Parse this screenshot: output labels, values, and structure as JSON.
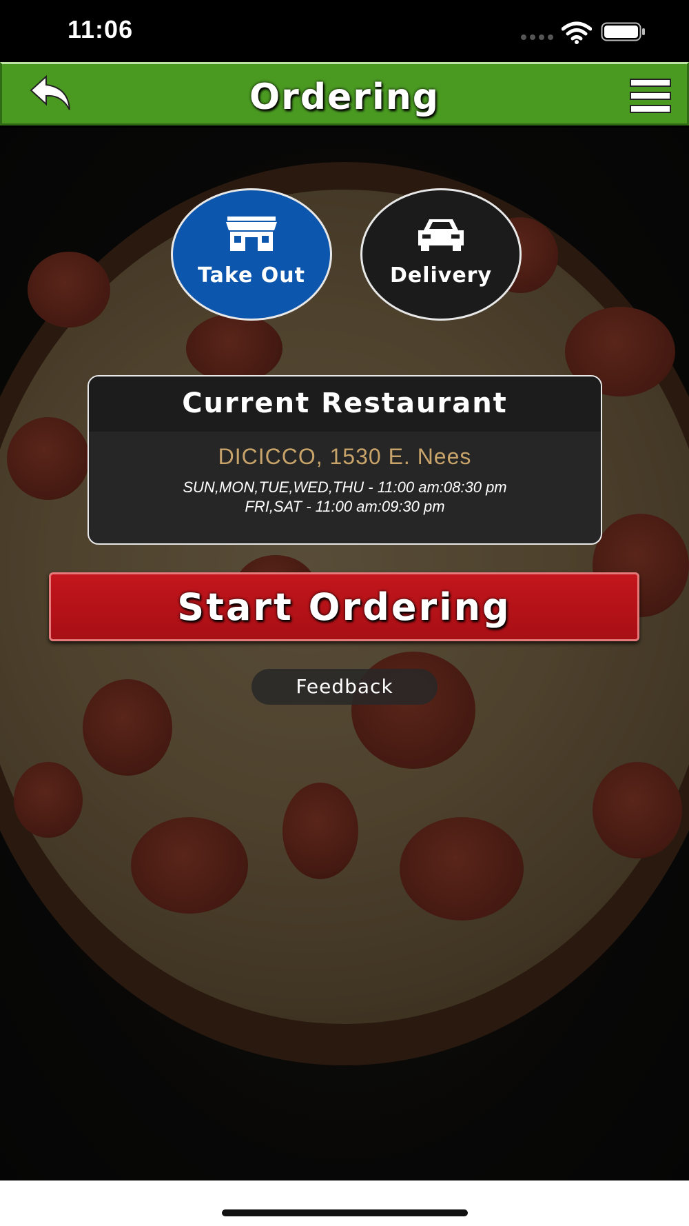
{
  "status_bar": {
    "time": "11:06",
    "icons": [
      "signal-dots-icon",
      "wifi-icon",
      "battery-icon"
    ]
  },
  "header": {
    "title": "Ordering",
    "back_icon": "back-arrow-icon",
    "menu_icon": "hamburger-menu-icon",
    "color": "#4a9a22"
  },
  "order_modes": [
    {
      "label": "Take Out",
      "icon": "storefront-icon",
      "selected": true,
      "color": "#0d56ad"
    },
    {
      "label": "Delivery",
      "icon": "car-icon",
      "selected": false,
      "color": "#1b1b1b"
    }
  ],
  "restaurant": {
    "heading": "Current Restaurant",
    "name": "DICICCO, 1530 E. Nees",
    "hours": [
      "SUN,MON,TUE,WED,THU - 11:00 am:08:30 pm",
      "FRI,SAT - 11:00 am:09:30 pm"
    ],
    "name_color": "#c9a46a"
  },
  "actions": {
    "start_label": "Start Ordering",
    "start_color": "#c2161c",
    "feedback_label": "Feedback"
  }
}
